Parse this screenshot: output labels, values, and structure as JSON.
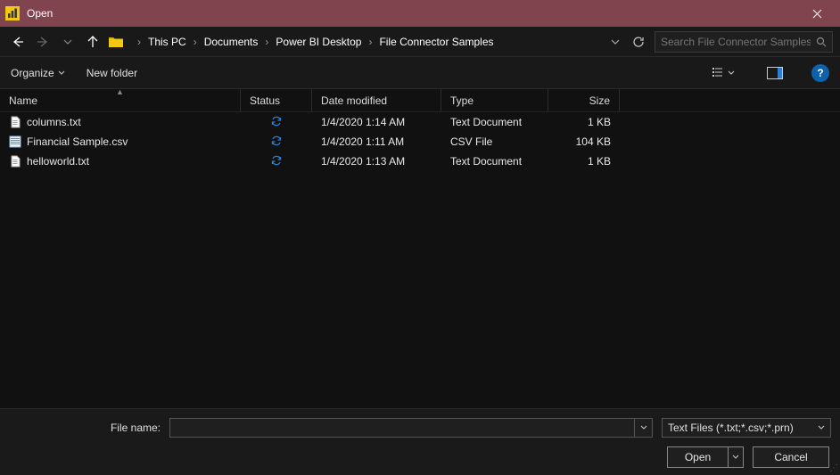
{
  "window": {
    "title": "Open"
  },
  "nav": {
    "breadcrumb": [
      "This PC",
      "Documents",
      "Power BI Desktop",
      "File Connector Samples"
    ],
    "search_placeholder": "Search File Connector Samples"
  },
  "toolbar": {
    "organize": "Organize",
    "new_folder": "New folder"
  },
  "columns": {
    "name": "Name",
    "status": "Status",
    "date": "Date modified",
    "type": "Type",
    "size": "Size"
  },
  "files": [
    {
      "name": "columns.txt",
      "icon": "txt",
      "date": "1/4/2020 1:14 AM",
      "type": "Text Document",
      "size": "1 KB"
    },
    {
      "name": "Financial Sample.csv",
      "icon": "csv",
      "date": "1/4/2020 1:11 AM",
      "type": "CSV File",
      "size": "104 KB"
    },
    {
      "name": "helloworld.txt",
      "icon": "txt",
      "date": "1/4/2020 1:13 AM",
      "type": "Text Document",
      "size": "1 KB"
    }
  ],
  "footer": {
    "filename_label": "File name:",
    "filename_value": "",
    "filter": "Text Files (*.txt;*.csv;*.prn)",
    "open": "Open",
    "cancel": "Cancel"
  }
}
